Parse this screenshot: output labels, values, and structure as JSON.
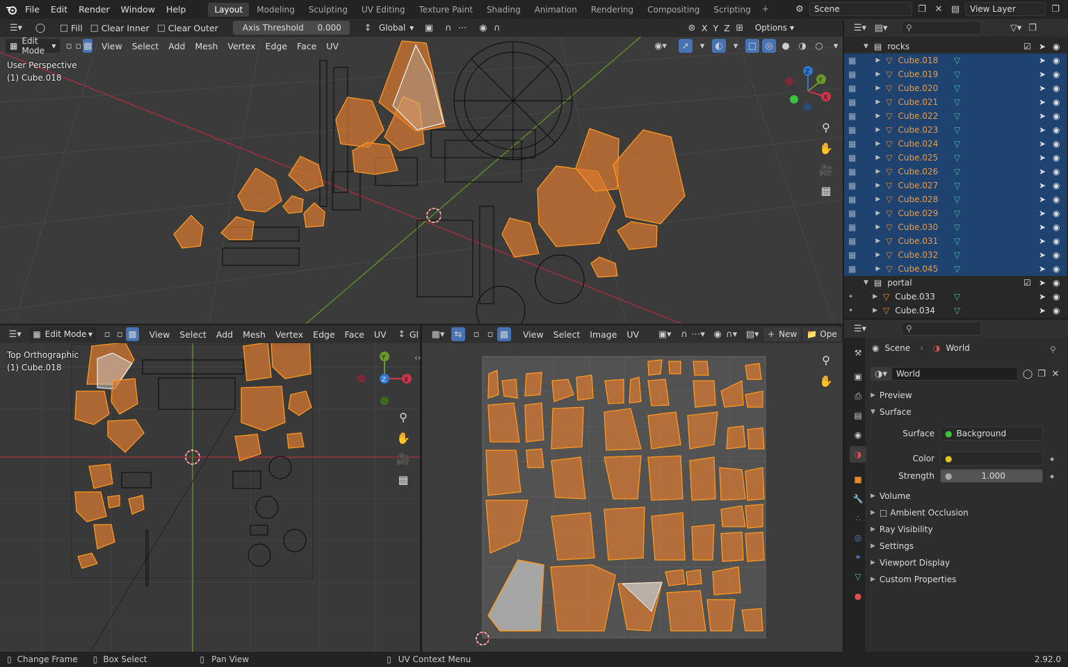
{
  "app": {
    "version": "2.92.0"
  },
  "menus": [
    "File",
    "Edit",
    "Render",
    "Window",
    "Help"
  ],
  "workspaces": [
    "Layout",
    "Modeling",
    "Sculpting",
    "UV Editing",
    "Texture Paint",
    "Shading",
    "Animation",
    "Rendering",
    "Compositing",
    "Scripting"
  ],
  "active_workspace": "Layout",
  "scene": {
    "label": "Scene",
    "view_layer": "View Layer"
  },
  "viewport3d": {
    "tool_header": {
      "fill": "Fill",
      "clear_inner": "Clear Inner",
      "clear_outer": "Clear Outer",
      "axis_threshold_label": "Axis Threshold",
      "axis_threshold_value": "0.000",
      "orientation": "Global",
      "axes": [
        "X",
        "Y",
        "Z"
      ],
      "options": "Options"
    },
    "mode": "Edit Mode",
    "menu": [
      "View",
      "Select",
      "Add",
      "Mesh",
      "Vertex",
      "Edge",
      "Face",
      "UV"
    ],
    "overlay_line1": "User Perspective",
    "overlay_line2": "(1) Cube.018",
    "gizmo": {
      "z": "Z",
      "y": "Y",
      "x": "X"
    }
  },
  "viewport_top": {
    "mode": "Edit Mode",
    "menu": [
      "View",
      "Select",
      "Add",
      "Mesh",
      "Vertex",
      "Edge",
      "Face",
      "UV"
    ],
    "truncated": "Gl",
    "overlay_line1": "Top Orthographic",
    "overlay_line2": "(1) Cube.018",
    "gizmo": {
      "y": "Y",
      "z": "Z",
      "x": "X"
    }
  },
  "uv_editor": {
    "menu": [
      "View",
      "Select",
      "Image",
      "UV"
    ],
    "new_label": "New",
    "open_label": "Ope"
  },
  "outliner": {
    "search_placeholder": "",
    "collections": [
      {
        "name": "rocks",
        "items": [
          "Cube.018",
          "Cube.019",
          "Cube.020",
          "Cube.021",
          "Cube.022",
          "Cube.023",
          "Cube.024",
          "Cube.025",
          "Cube.026",
          "Cube.027",
          "Cube.028",
          "Cube.029",
          "Cube.030",
          "Cube.031",
          "Cube.032",
          "Cube.045"
        ]
      },
      {
        "name": "portal",
        "items": [
          "Cube.033",
          "Cube.034"
        ]
      }
    ]
  },
  "properties": {
    "breadcrumb": {
      "scene": "Scene",
      "world": "World"
    },
    "world_name": "World",
    "panels": {
      "preview": "Preview",
      "surface": "Surface",
      "volume": "Volume",
      "ambient_occlusion": "Ambient Occlusion",
      "ray_visibility": "Ray Visibility",
      "settings": "Settings",
      "viewport_display": "Viewport Display",
      "custom_properties": "Custom Properties"
    },
    "surface_label": "Surface",
    "surface_value": "Background",
    "color_label": "Color",
    "strength_label": "Strength",
    "strength_value": "1.000"
  },
  "statusbar": {
    "change_frame": "Change Frame",
    "box_select": "Box Select",
    "pan_view": "Pan View",
    "uv_context": "UV Context Menu"
  },
  "colors": {
    "selection": "#1f4371",
    "accent_orange": "#ff9a1f",
    "active_blue": "#4772b3",
    "x_axis": "#c8364b",
    "y_axis": "#6a9a2a",
    "z_axis": "#2f77d0"
  }
}
